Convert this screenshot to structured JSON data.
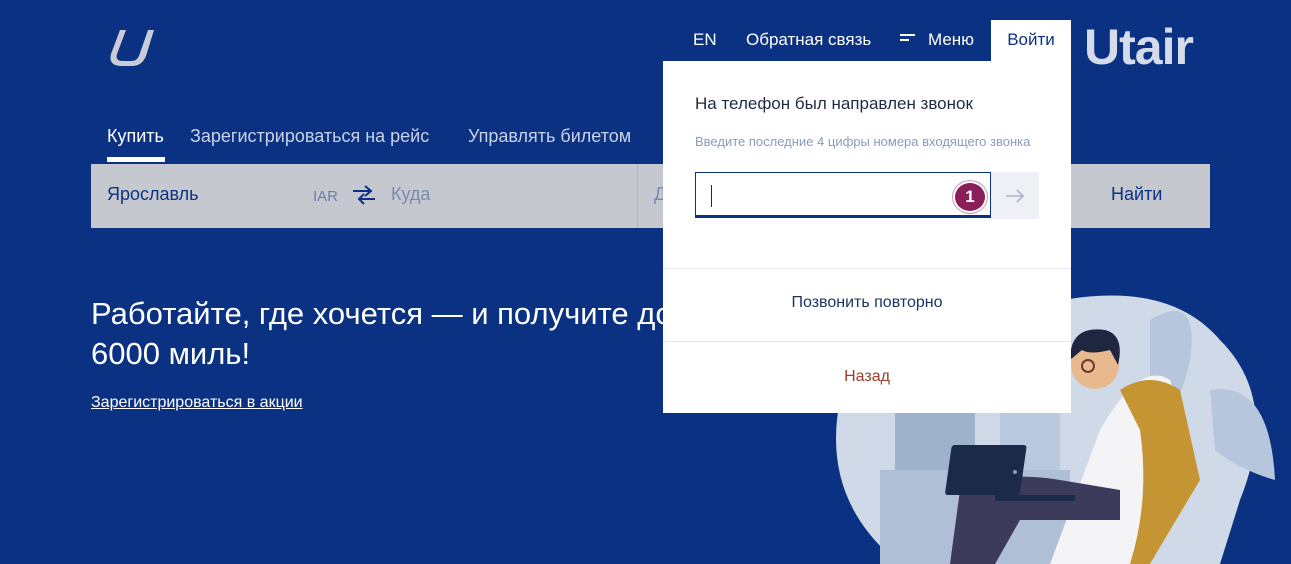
{
  "header": {
    "brand": "Utair",
    "nav": {
      "lang": "EN",
      "feedback": "Обратная связь",
      "menu": "Меню",
      "login": "Войти"
    }
  },
  "tabs": [
    {
      "label": "Купить",
      "active": true
    },
    {
      "label": "Зарегистрироваться на рейс",
      "active": false
    },
    {
      "label": "Управлять билетом",
      "active": false
    }
  ],
  "search": {
    "from_city": "Ярославль",
    "from_code": "IAR",
    "to_placeholder": "Куда",
    "date_placeholder": "Д",
    "find_button": "Найти"
  },
  "promo": {
    "title": "Работайте, где хочется — и получите до 6000 миль!",
    "link": "Зарегистрироваться в акции"
  },
  "modal": {
    "title": "На телефон был направлен звонок",
    "hint": "Введите последние 4 цифры номера входящего звонка",
    "code_value": "",
    "badge": "1",
    "recall": "Позвонить повторно",
    "back": "Назад"
  },
  "colors": {
    "background": "#0b3282",
    "searchbar": "#c5c8cf",
    "badge": "#8a1d5a",
    "back_link": "#9a3f2c"
  }
}
